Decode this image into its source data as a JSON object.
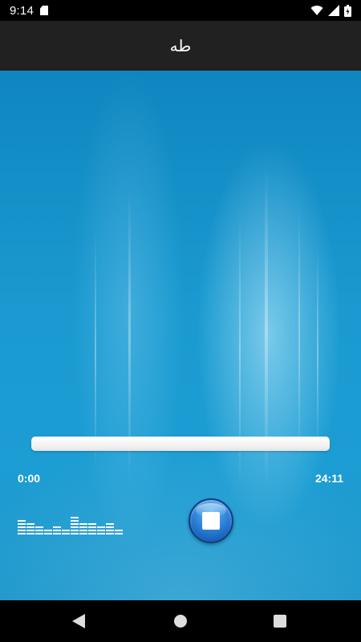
{
  "status_bar": {
    "time": "9:14",
    "icons": [
      "sd-card-icon",
      "wifi-icon",
      "cell-signal-icon",
      "battery-icon"
    ]
  },
  "app_bar": {
    "title": "طه"
  },
  "player": {
    "current_time": "0:00",
    "total_time": "24:11",
    "progress_fraction": 0.0,
    "equalizer_levels": [
      5,
      4,
      3,
      2,
      3,
      2,
      6,
      4,
      4,
      3,
      4,
      2
    ],
    "stop_button_icon": "stop-icon"
  },
  "nav_bar": {
    "icons": [
      "back-icon",
      "home-icon",
      "recents-icon"
    ]
  },
  "colors": {
    "app_bar_bg": "#212121",
    "background_blue": "#1a9ad0",
    "button_blue": "#2a7fd6"
  }
}
